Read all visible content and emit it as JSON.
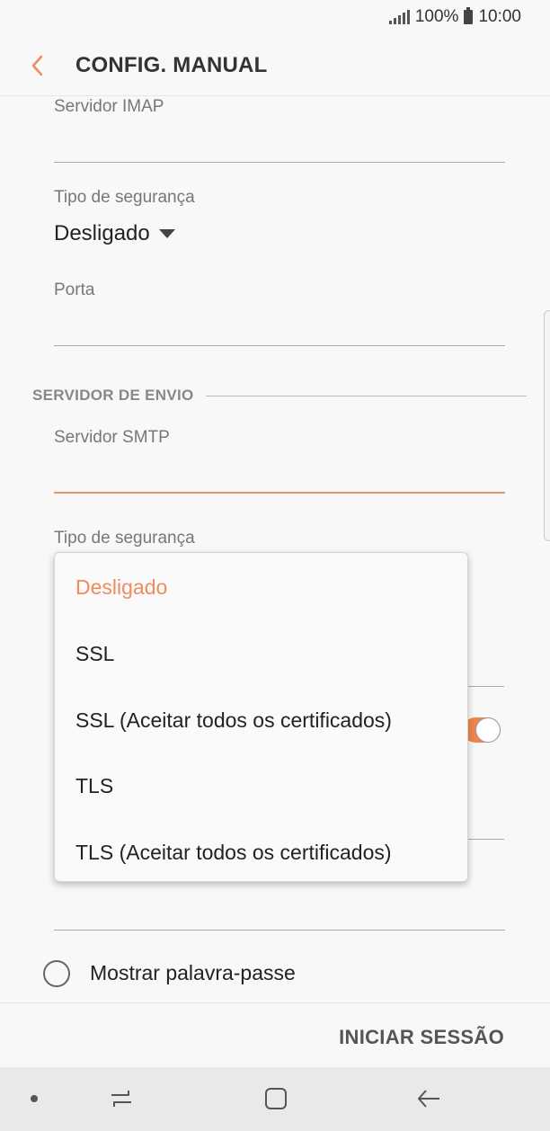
{
  "status_bar": {
    "battery": "100%",
    "time": "10:00"
  },
  "header": {
    "title": "CONFIG. MANUAL"
  },
  "incoming": {
    "imap_label": "Servidor IMAP",
    "security_label": "Tipo de segurança",
    "security_value": "Desligado",
    "port_label": "Porta"
  },
  "outgoing": {
    "section_title": "SERVIDOR DE ENVIO",
    "smtp_label": "Servidor SMTP",
    "security_label": "Tipo de segurança"
  },
  "dropdown": {
    "options": [
      {
        "label": "Desligado",
        "selected": true
      },
      {
        "label": "SSL"
      },
      {
        "label": "SSL (Aceitar todos os certificados)"
      },
      {
        "label": "TLS"
      },
      {
        "label": "TLS (Aceitar todos os certificados)"
      }
    ]
  },
  "show_password_label": "Mostrar palavra-passe",
  "login_button": "INICIAR SESSÃO",
  "colors": {
    "accent": "#ee8c5d",
    "background": "#f8f8f8"
  }
}
